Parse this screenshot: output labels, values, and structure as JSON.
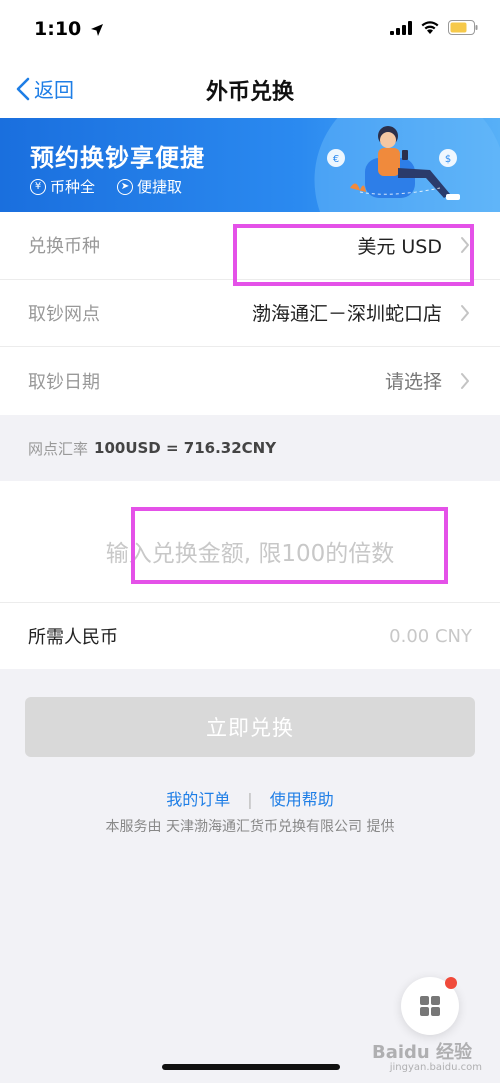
{
  "status_bar": {
    "time": "1:10"
  },
  "nav": {
    "back_label": "返回",
    "title": "外币兑换"
  },
  "banner": {
    "title": "预约换钞享便捷",
    "tags": [
      {
        "icon": "yen-icon",
        "label": "币种全"
      },
      {
        "icon": "send-icon",
        "label": "便捷取"
      }
    ]
  },
  "form": {
    "rows": [
      {
        "label": "兑换币种",
        "value": "美元 USD"
      },
      {
        "label": "取钞网点",
        "value": "渤海通汇－深圳蛇口店"
      },
      {
        "label": "取钞日期",
        "value": "请选择"
      }
    ]
  },
  "rate": {
    "label": "网点汇率",
    "value": "100USD = 716.32CNY"
  },
  "amount": {
    "placeholder": "输入兑换金额, 限100的倍数",
    "rmb_label": "所需人民币",
    "rmb_value": "0.00 CNY"
  },
  "submit": {
    "label": "立即兑换"
  },
  "links": {
    "orders": "我的订单",
    "help": "使用帮助"
  },
  "provider": "本服务由 天津渤海通汇货币兑换有限公司 提供",
  "colors": {
    "accent": "#1e7ee6",
    "highlight": "#e451e8",
    "badge": "#f04a3a"
  }
}
